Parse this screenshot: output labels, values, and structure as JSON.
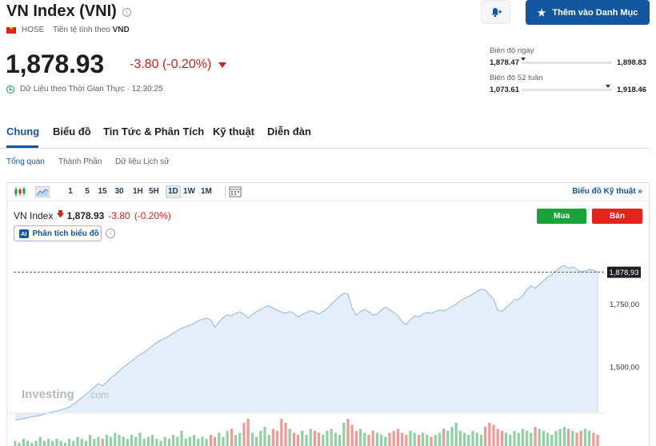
{
  "header": {
    "title": "VN Index (VNI)",
    "exchange": "HOSE",
    "currency_label": "Tiền tệ tính theo",
    "currency": "VND",
    "price": "1,878.93",
    "change": "-3.80 (-0.20%)",
    "realtime_text": "Dữ Liệu theo Thời Gian Thực · 12:30:25",
    "watchlist_button": "Thêm vào Danh Mục"
  },
  "ranges": {
    "day": {
      "label": "Biên độ ngày",
      "low": "1,878.47",
      "high": "1,898.83",
      "marker_fraction": 0.02
    },
    "week52": {
      "label": "Biên độ 52 tuần",
      "low": "1,073.61",
      "high": "1,918.46",
      "marker_fraction": 0.96
    }
  },
  "tabs": [
    {
      "label": "Chung",
      "active": true
    },
    {
      "label": "Biểu đồ",
      "active": false
    },
    {
      "label": "Tin Tức & Phân Tích",
      "active": false
    },
    {
      "label": "Kỹ thuật",
      "active": false
    },
    {
      "label": "Diễn đàn",
      "active": false
    }
  ],
  "subtabs": [
    {
      "label": "Tổng quan",
      "active": true
    },
    {
      "label": "Thành Phần",
      "active": false
    },
    {
      "label": "Dữ liệu Lịch sử",
      "active": false
    }
  ],
  "toolbar": {
    "intervals": [
      {
        "label": "1",
        "active": false
      },
      {
        "label": "5",
        "active": false
      },
      {
        "label": "15",
        "active": false
      },
      {
        "label": "30",
        "active": false
      },
      {
        "label": "1H",
        "active": false
      },
      {
        "label": "5H",
        "active": false
      },
      {
        "label": "1D",
        "active": true
      },
      {
        "label": "1W",
        "active": false
      },
      {
        "label": "1M",
        "active": false
      }
    ],
    "tech_chart_link": "Biểu đồ Kỹ thuật »"
  },
  "chart_legend": {
    "name": "VN Index",
    "price": "1,878.93",
    "change": "-3.80",
    "change_pct": "(-0.20%)"
  },
  "trade": {
    "buy": "Mua",
    "sell": "Bán"
  },
  "ai_button": "Phân tích biểu đồ",
  "watermark": {
    "brand": "Investing",
    "suffix": ".com"
  },
  "colors": {
    "accent": "#1256a0",
    "down": "#d91e18",
    "up": "#1aa33a",
    "area_fill": "#e3eef8",
    "area_line": "#8ab9e0"
  },
  "chart_data": {
    "type": "area",
    "y_ticks": [
      "1,750,00",
      "1,500,00"
    ],
    "y_tick_values": [
      1750,
      1500
    ],
    "current_label": "1,878,93",
    "current_value": 1878.93,
    "ylim": [
      1230,
      2100
    ],
    "grid": false,
    "values": [
      1290,
      1292,
      1295,
      1298,
      1302,
      1305,
      1308,
      1312,
      1318,
      1322,
      1325,
      1330,
      1335,
      1340,
      1352,
      1365,
      1378,
      1392,
      1405,
      1420,
      1435,
      1425,
      1440,
      1458,
      1470,
      1485,
      1500,
      1512,
      1525,
      1538,
      1550,
      1560,
      1572,
      1585,
      1598,
      1608,
      1615,
      1625,
      1635,
      1645,
      1655,
      1662,
      1668,
      1675,
      1685,
      1692,
      1695,
      1688,
      1660,
      1680,
      1698,
      1710,
      1705,
      1715,
      1720,
      1712,
      1695,
      1710,
      1722,
      1730,
      1740,
      1745,
      1735,
      1728,
      1720,
      1715,
      1722,
      1715,
      1700,
      1710,
      1718,
      1725,
      1720,
      1712,
      1722,
      1735,
      1752,
      1768,
      1782,
      1795,
      1792,
      1735,
      1708,
      1722,
      1730,
      1720,
      1708,
      1712,
      1728,
      1740,
      1730,
      1718,
      1705,
      1682,
      1670,
      1690,
      1705,
      1700,
      1712,
      1718,
      1715,
      1722,
      1728,
      1725,
      1732,
      1742,
      1752,
      1765,
      1775,
      1782,
      1792,
      1802,
      1812,
      1808,
      1790,
      1770,
      1728,
      1722,
      1738,
      1752,
      1770,
      1770,
      1785,
      1810,
      1825,
      1815,
      1830,
      1845,
      1860,
      1870,
      1885,
      1898,
      1906,
      1895,
      1900,
      1892,
      1880,
      1885,
      1890,
      1888,
      1880
    ],
    "volumes": [
      3,
      2,
      4,
      3,
      2,
      3,
      5,
      3,
      4,
      3,
      4,
      3,
      2,
      4,
      3,
      5,
      4,
      3,
      6,
      4,
      5,
      4,
      6,
      5,
      7,
      6,
      5,
      4,
      6,
      5,
      7,
      4,
      5,
      6,
      4,
      3,
      5,
      4,
      6,
      5,
      8,
      4,
      5,
      6,
      4,
      5,
      4,
      6,
      5,
      7,
      5,
      8,
      9,
      6,
      7,
      12,
      14,
      7,
      5,
      8,
      10,
      6,
      9,
      8,
      14,
      12,
      9,
      7,
      6,
      8,
      6,
      9,
      8,
      7,
      6,
      8,
      9,
      7,
      6,
      12,
      14,
      11,
      8,
      9,
      7,
      6,
      8,
      7,
      6,
      5,
      7,
      8,
      9,
      7,
      6,
      8,
      7,
      6,
      7,
      6,
      5,
      6,
      7,
      9,
      8,
      10,
      12,
      8,
      7,
      6,
      8,
      7,
      6,
      10,
      12,
      11,
      9,
      8,
      7,
      6,
      8,
      7,
      9,
      8,
      7,
      10,
      9,
      8,
      7,
      6,
      8,
      9,
      10,
      9,
      8,
      7,
      8,
      9,
      8,
      7,
      6
    ]
  }
}
